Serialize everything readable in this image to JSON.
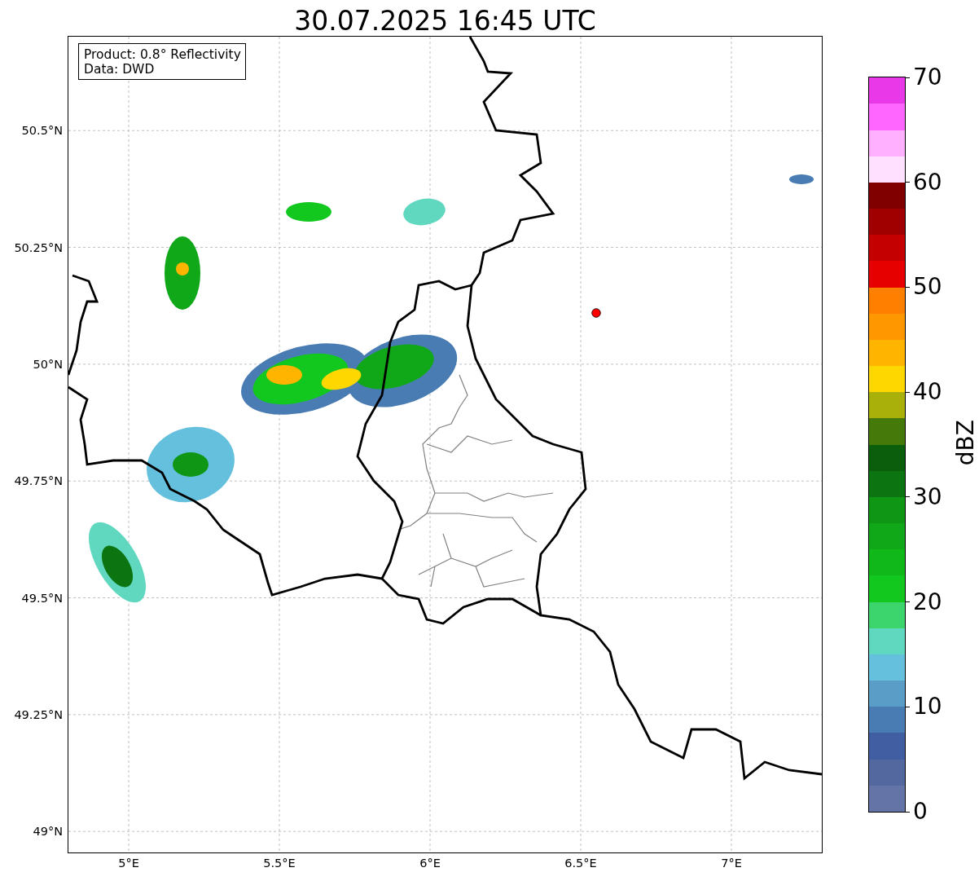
{
  "title": "30.07.2025 16:45 UTC",
  "map": {
    "info": [
      "Product: 0.8° Reflectivity",
      "Data: DWD"
    ],
    "yticks": [
      "50.5°N",
      "50.25°N",
      "50°N",
      "49.75°N",
      "49.5°N",
      "49.25°N",
      "49°N"
    ],
    "xticks": [
      "5°E",
      "5.5°E",
      "6°E",
      "6.5°E",
      "7°E"
    ],
    "marker": {
      "color": "#ff0000"
    }
  },
  "colorbar": {
    "label": "dBZ",
    "ticks": [
      "70",
      "60",
      "50",
      "40",
      "30",
      "20",
      "10",
      "0"
    ],
    "segments": [
      {
        "color": "#6474a6"
      },
      {
        "color": "#5468a0"
      },
      {
        "color": "#425ea2"
      },
      {
        "color": "#4a7cb4"
      },
      {
        "color": "#5a9ec8"
      },
      {
        "color": "#64c0dc"
      },
      {
        "color": "#60d8c0"
      },
      {
        "color": "#3cd46c"
      },
      {
        "color": "#12c81e"
      },
      {
        "color": "#10b81a"
      },
      {
        "color": "#10a818"
      },
      {
        "color": "#0e9614"
      },
      {
        "color": "#0c7410"
      },
      {
        "color": "#0a5e0c"
      },
      {
        "color": "#457a0a"
      },
      {
        "color": "#aab00a"
      },
      {
        "color": "#ffd700"
      },
      {
        "color": "#ffb400"
      },
      {
        "color": "#ff9800"
      },
      {
        "color": "#ff7f00"
      },
      {
        "color": "#e60000"
      },
      {
        "color": "#c40000"
      },
      {
        "color": "#a00000"
      },
      {
        "color": "#800000"
      },
      {
        "color": "#ffe0ff"
      },
      {
        "color": "#ffb0ff"
      },
      {
        "color": "#ff66ff"
      },
      {
        "color": "#e838e8"
      }
    ]
  }
}
